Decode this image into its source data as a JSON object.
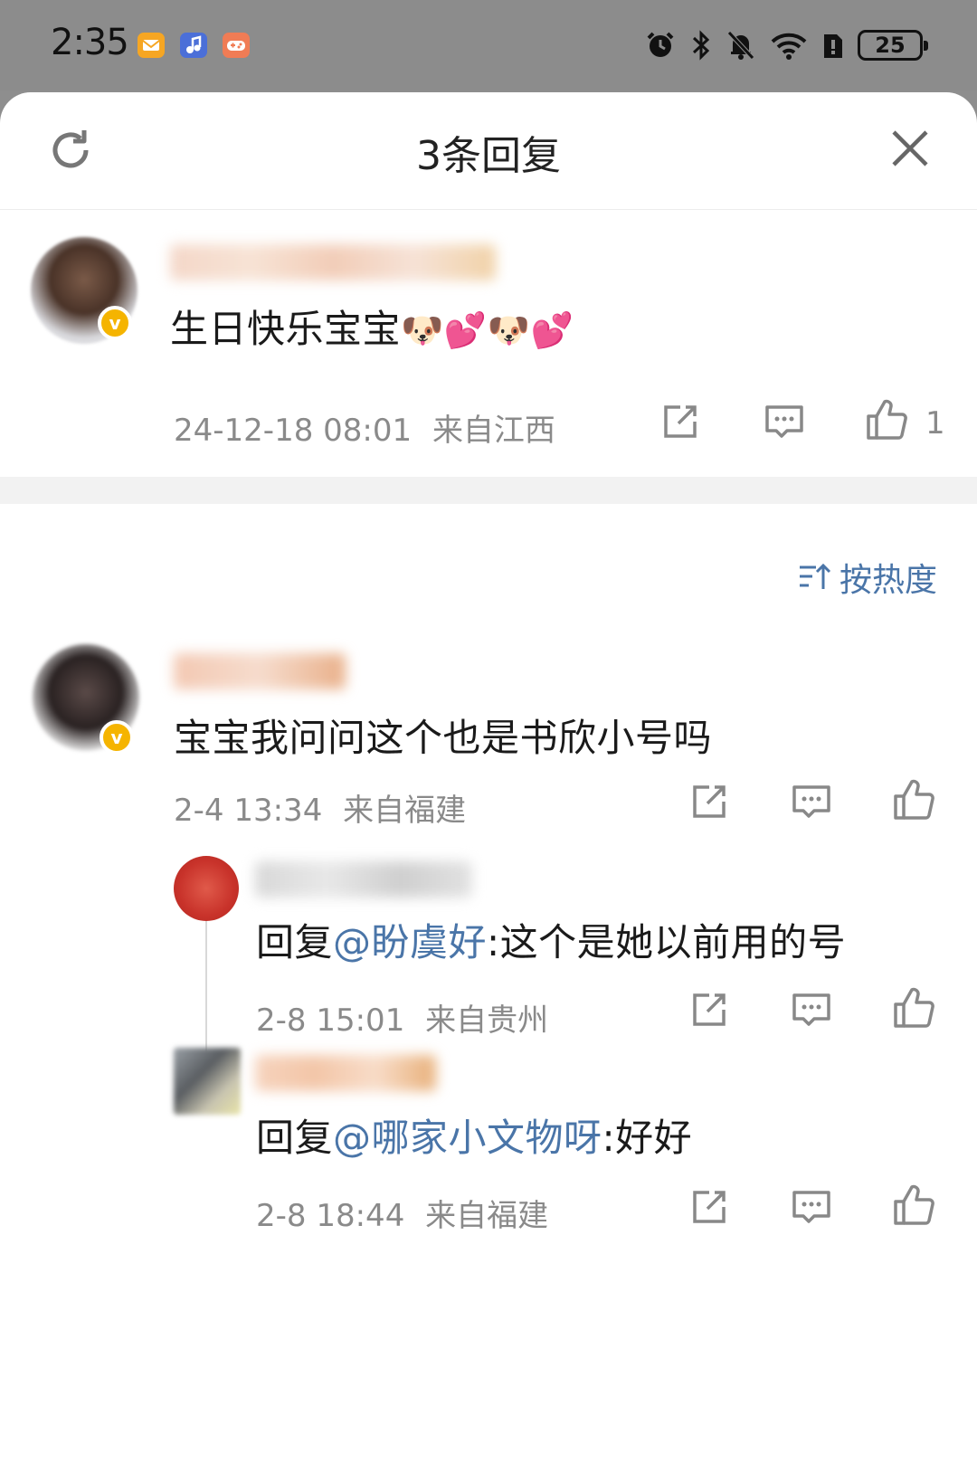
{
  "status_bar": {
    "time": "2:35",
    "battery": "25",
    "app_icons": [
      "mail-icon",
      "music-icon",
      "game-icon"
    ],
    "indicators": [
      "alarm-icon",
      "bluetooth-icon",
      "mute-icon",
      "wifi-icon",
      "sim-icon"
    ]
  },
  "sheet": {
    "title": "3条回复",
    "refresh_icon": "refresh-icon",
    "close_icon": "close-icon"
  },
  "main_comment": {
    "text": "生日快乐宝宝",
    "emoji": "🐶💕🐶💕",
    "time": "24-12-18 08:01",
    "location": "来自江西",
    "like_count": "1"
  },
  "sort": {
    "label": "按热度",
    "icon": "sort-icon"
  },
  "replies": [
    {
      "text": "宝宝我问问这个也是书欣小号吗",
      "time": "2-4 13:34",
      "location": "来自福建"
    },
    {
      "prefix": "回复",
      "mention": "@盼虞好",
      "suffix": ":这个是她以前用的号",
      "time": "2-8 15:01",
      "location": "来自贵州"
    },
    {
      "prefix": "回复",
      "mention": "@哪家小文物呀",
      "suffix": ":好好",
      "time": "2-8 18:44",
      "location": "来自福建"
    }
  ],
  "colors": {
    "accent": "#4a75a8",
    "meta_text": "#8a8a8a",
    "verified_badge": "#f5b400"
  }
}
